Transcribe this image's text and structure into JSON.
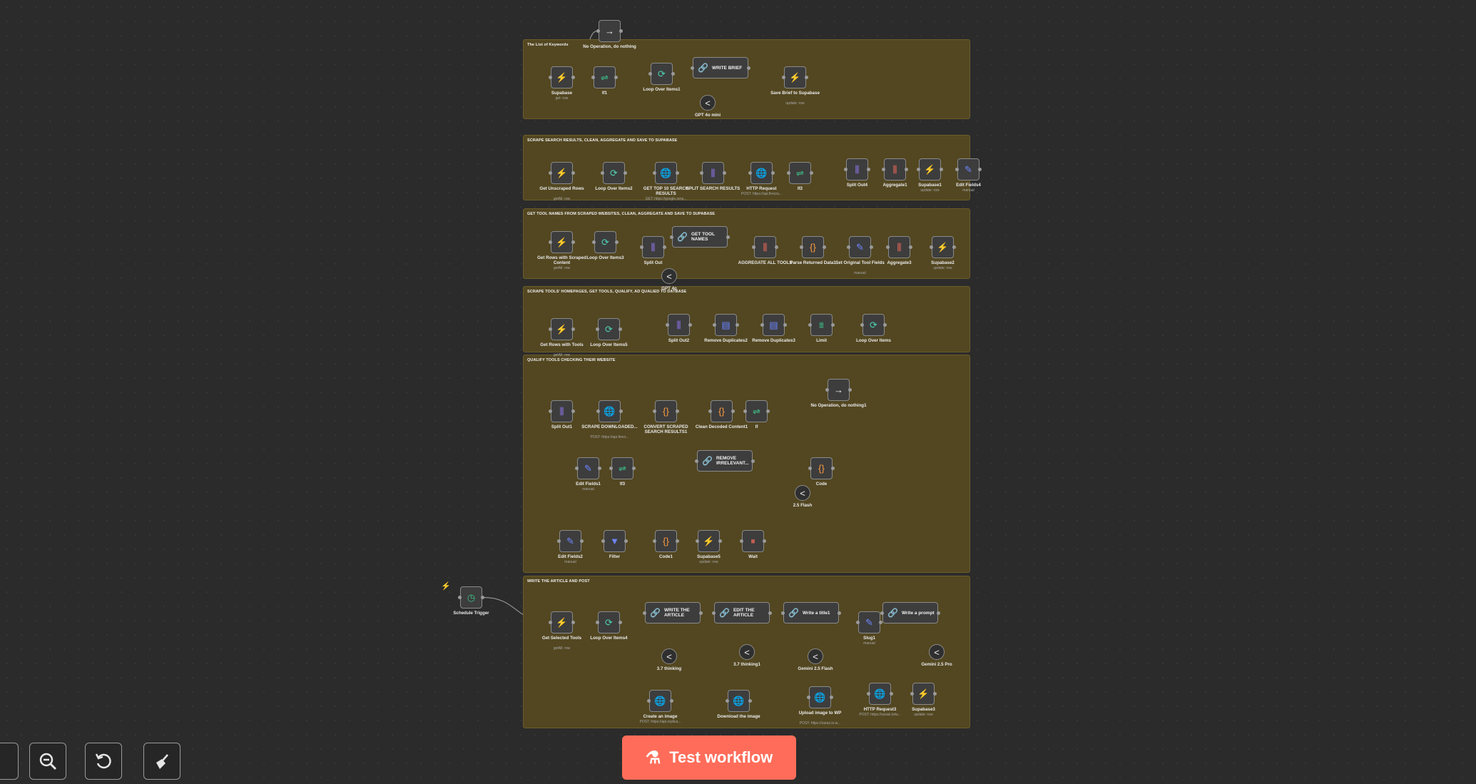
{
  "groups": [
    {
      "title": "The List of Keywords"
    },
    {
      "title": "SCRAPE SEARCH RESULTS, CLEAN, AGGREGATE AND SAVE TO SUPABASE"
    },
    {
      "title": "GET TOOL NAMES FROM SCRAPED WEBSITES, CLEAN, AGGREGATE AND SAVE TO SUPABASE"
    },
    {
      "title": "SCRAPE TOOLS' HOMEPAGES, GET TOOLS, QUALIFY, AD QUALIED TO DATBASE"
    },
    {
      "title": "QUALIFY TOOLS CHECKING THEIR WEBSITE"
    },
    {
      "title": "WRITE THE ARTICLE AND POST"
    }
  ],
  "nodes": [
    {
      "label": "No Operation, do nothing",
      "sub": "",
      "icon": "→",
      "color": "white"
    },
    {
      "label": "Supabase",
      "sub": "get: row",
      "icon": "⚡",
      "color": "green"
    },
    {
      "label": "If1",
      "sub": "",
      "icon": "⇌",
      "color": "green"
    },
    {
      "label": "Loop Over Items1",
      "sub": "",
      "icon": "⟳",
      "color": "teal"
    },
    {
      "label": "WRITE BRIEF",
      "sub": "",
      "icon": "🔗",
      "color": "white"
    },
    {
      "label": "Save Brief to Supabase",
      "sub": "update: row",
      "icon": "⚡",
      "color": "green"
    },
    {
      "label": "GPT 4o mini",
      "sub": "",
      "icon": "<",
      "color": "white"
    },
    {
      "label": "Get Unscraped Rows",
      "sub": "getAll: row",
      "icon": "⚡",
      "color": "green"
    },
    {
      "label": "Loop Over Items2",
      "sub": "",
      "icon": "⟳",
      "color": "teal"
    },
    {
      "label": "GET TOP 10 SEARCH RESULTS",
      "sub": "GET: https://google.serp...",
      "icon": "🌐",
      "color": "purple"
    },
    {
      "label": "SPLIT SEARCH RESULTS",
      "sub": "",
      "icon": "⫼",
      "color": "purple"
    },
    {
      "label": "HTTP Request",
      "sub": "POST: https://api.firecra...",
      "icon": "🌐",
      "color": "purple"
    },
    {
      "label": "If2",
      "sub": "",
      "icon": "⇌",
      "color": "green"
    },
    {
      "label": "Split Out4",
      "sub": "",
      "icon": "⫼",
      "color": "purple"
    },
    {
      "label": "Aggregate1",
      "sub": "",
      "icon": "⫼",
      "color": "red"
    },
    {
      "label": "Supabase1",
      "sub": "update: row",
      "icon": "⚡",
      "color": "green"
    },
    {
      "label": "Edit Fields4",
      "sub": "manual",
      "icon": "✎",
      "color": "blue"
    },
    {
      "label": "Get Rows with Scraped Content",
      "sub": "getAll: row",
      "icon": "⚡",
      "color": "green"
    },
    {
      "label": "Loop Over Items3",
      "sub": "",
      "icon": "⟳",
      "color": "teal"
    },
    {
      "label": "Split Out",
      "sub": "",
      "icon": "⫼",
      "color": "purple"
    },
    {
      "label": "GET TOOL NAMES",
      "sub": "",
      "icon": "🔗",
      "color": "white"
    },
    {
      "label": "AGGREGATE ALL TOOLS",
      "sub": "",
      "icon": "⫼",
      "color": "red"
    },
    {
      "label": "Parse Returned Data1",
      "sub": "",
      "icon": "{}",
      "color": "orange"
    },
    {
      "label": "Set Original Tool Fields",
      "sub": "manual",
      "icon": "✎",
      "color": "blue"
    },
    {
      "label": "Aggregate3",
      "sub": "",
      "icon": "⫼",
      "color": "red"
    },
    {
      "label": "Supabase2",
      "sub": "update: row",
      "icon": "⚡",
      "color": "green"
    },
    {
      "label": "GPT 4o",
      "sub": "",
      "icon": "<",
      "color": "white"
    },
    {
      "label": "Get Rows with Tools",
      "sub": "getAll: row",
      "icon": "⚡",
      "color": "green"
    },
    {
      "label": "Loop Over Items5",
      "sub": "",
      "icon": "⟳",
      "color": "teal"
    },
    {
      "label": "Split Out2",
      "sub": "",
      "icon": "⫼",
      "color": "purple"
    },
    {
      "label": "Remove Duplicates2",
      "sub": "",
      "icon": "▤",
      "color": "blue"
    },
    {
      "label": "Remove Duplicates3",
      "sub": "",
      "icon": "▤",
      "color": "blue"
    },
    {
      "label": "Limit",
      "sub": "",
      "icon": "⩩",
      "color": "green"
    },
    {
      "label": "Loop Over Items",
      "sub": "",
      "icon": "⟳",
      "color": "teal"
    },
    {
      "label": "Split Out1",
      "sub": "",
      "icon": "⫼",
      "color": "purple"
    },
    {
      "label": "SCRAPE DOWNLOADED...",
      "sub": "POST: https://api.firecr...",
      "icon": "🌐",
      "color": "purple"
    },
    {
      "label": "CONVERT SCRAPED SEARCH RESULTS1",
      "sub": "",
      "icon": "{}",
      "color": "orange"
    },
    {
      "label": "Clean Decoded Content1",
      "sub": "",
      "icon": "{}",
      "color": "orange"
    },
    {
      "label": "If",
      "sub": "",
      "icon": "⇌",
      "color": "green"
    },
    {
      "label": "No Operation, do nothing1",
      "sub": "",
      "icon": "→",
      "color": "white"
    },
    {
      "label": "Edit Fields1",
      "sub": "manual",
      "icon": "✎",
      "color": "blue"
    },
    {
      "label": "If3",
      "sub": "",
      "icon": "⇌",
      "color": "green"
    },
    {
      "label": "REMOVE IRRELEVANT...",
      "sub": "",
      "icon": "🔗",
      "color": "white"
    },
    {
      "label": "Code",
      "sub": "",
      "icon": "{}",
      "color": "orange"
    },
    {
      "label": "2.5 Flash",
      "sub": "",
      "icon": "<",
      "color": "white"
    },
    {
      "label": "Edit Fields2",
      "sub": "manual",
      "icon": "✎",
      "color": "blue"
    },
    {
      "label": "Filter",
      "sub": "",
      "icon": "▼",
      "color": "blue"
    },
    {
      "label": "Code1",
      "sub": "",
      "icon": "{}",
      "color": "orange"
    },
    {
      "label": "Supabase5",
      "sub": "update: row",
      "icon": "⚡",
      "color": "green"
    },
    {
      "label": "Wait",
      "sub": "",
      "icon": "⏸",
      "color": "red"
    },
    {
      "label": "Schedule Trigger",
      "sub": "",
      "icon": "◷",
      "color": "green"
    },
    {
      "label": "Get Selected Tools",
      "sub": "getAll: row",
      "icon": "⚡",
      "color": "green"
    },
    {
      "label": "Loop Over Items4",
      "sub": "",
      "icon": "⟳",
      "color": "teal"
    },
    {
      "label": "WRITE THE ARTICLE",
      "sub": "",
      "icon": "🔗",
      "color": "white"
    },
    {
      "label": "EDIT THE ARTICLE",
      "sub": "",
      "icon": "🔗",
      "color": "white"
    },
    {
      "label": "Write a title1",
      "sub": "",
      "icon": "🔗",
      "color": "white"
    },
    {
      "label": "Slug1",
      "sub": "manual",
      "icon": "✎",
      "color": "blue"
    },
    {
      "label": "Write a prompt",
      "sub": "",
      "icon": "🔗",
      "color": "white"
    },
    {
      "label": "3.7 thinking",
      "sub": "",
      "icon": "<",
      "color": "white"
    },
    {
      "label": "3.7 thinking1",
      "sub": "",
      "icon": "<",
      "color": "white"
    },
    {
      "label": "Gemini 2.5 Flash",
      "sub": "",
      "icon": "<",
      "color": "white"
    },
    {
      "label": "Gemini 2.5 Pro",
      "sub": "",
      "icon": "<",
      "color": "white"
    },
    {
      "label": "Create an image",
      "sub": "POST: https://api.replica...",
      "icon": "🌐",
      "color": "purple"
    },
    {
      "label": "Download the image",
      "sub": "",
      "icon": "🌐",
      "color": "purple"
    },
    {
      "label": "Upload image to WP",
      "sub": "POST: https://zaraz.io.w...",
      "icon": "🌐",
      "color": "purple"
    },
    {
      "label": "HTTP Request3",
      "sub": "POST: https://zarazi.io/w...",
      "icon": "🌐",
      "color": "purple"
    },
    {
      "label": "Supabase3",
      "sub": "update: row",
      "icon": "⚡",
      "color": "green"
    }
  ],
  "toolbar": {
    "zoom_out_icon": "zoom-out-icon",
    "reset_icon": "undo-icon",
    "tidy_icon": "broom-icon",
    "test_workflow_label": "Test workflow"
  }
}
